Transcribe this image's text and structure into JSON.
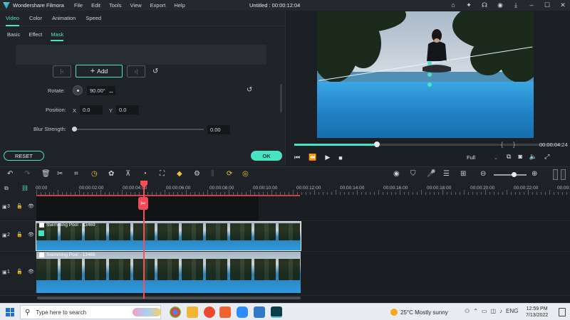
{
  "titlebar": {
    "app_name": "Wondershare Filmora",
    "menu": [
      "File",
      "Edit",
      "Tools",
      "View",
      "Export",
      "Help"
    ],
    "title": "Untitled : 00:00:12:04"
  },
  "edit_panel": {
    "tabs": [
      "Video",
      "Color",
      "Animation",
      "Speed"
    ],
    "active_tab": "Video",
    "subtabs": [
      "Basic",
      "Effect",
      "Mask"
    ],
    "active_subtab": "Mask",
    "add_label": "Add",
    "rotate": {
      "label": "Rotate:",
      "value": "90.00°"
    },
    "position": {
      "label": "Position:",
      "x_label": "X",
      "x_value": "0.0",
      "y_label": "Y",
      "y_value": "0.0"
    },
    "blur": {
      "label": "Blur Strength:",
      "value": "0.00",
      "level": 0
    },
    "reset_label": "RESET",
    "ok_label": "OK"
  },
  "preview": {
    "timecode": "00:00:04:24",
    "progress": 0.31,
    "quality": "Full"
  },
  "timeline": {
    "ruler": [
      "00:00",
      "00:00:02:00",
      "00:00:04:00",
      "00:00:06:00",
      "00:00:08:00",
      "00:00:10:00",
      "00:00:12:00",
      "00:00:14:00",
      "00:00:16:00",
      "00:00:18:00",
      "00:00:20:00",
      "00:00:22:00",
      "00:00:24:00"
    ],
    "tracks": [
      {
        "number": "3",
        "clip": ""
      },
      {
        "number": "2",
        "clip": "Swimming Pool - 13469"
      },
      {
        "number": "1",
        "clip": "Swimming Pool - 13469"
      }
    ],
    "zoom": 0.6
  },
  "taskbar": {
    "search_placeholder": "Type here to search",
    "weather": "25°C  Mostly sunny",
    "lang": "ENG",
    "time": "12:59 PM",
    "date": "7/13/2022"
  }
}
